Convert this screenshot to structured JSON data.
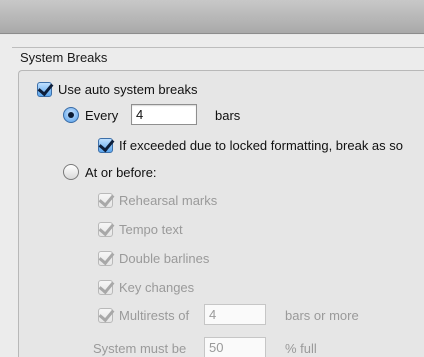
{
  "section": {
    "title": "System Breaks"
  },
  "auto_breaks": {
    "label": "Use auto system breaks",
    "checked": true
  },
  "every": {
    "label": "Every",
    "value": "4",
    "suffix": "bars",
    "selected": true,
    "locked_formatting_label": "If exceeded due to locked formatting, break as so",
    "locked_formatting_checked": true
  },
  "at_or_before": {
    "label": "At or before:",
    "selected": false,
    "options": {
      "rehearsal_marks": "Rehearsal marks",
      "tempo_text": "Tempo text",
      "double_barlines": "Double barlines",
      "key_changes": "Key changes",
      "multirests": "Multirests of"
    },
    "multirests_value": "4",
    "multirests_suffix": "bars or more",
    "system_full_label": "System must be",
    "system_full_value": "50",
    "system_full_suffix": "% full"
  }
}
